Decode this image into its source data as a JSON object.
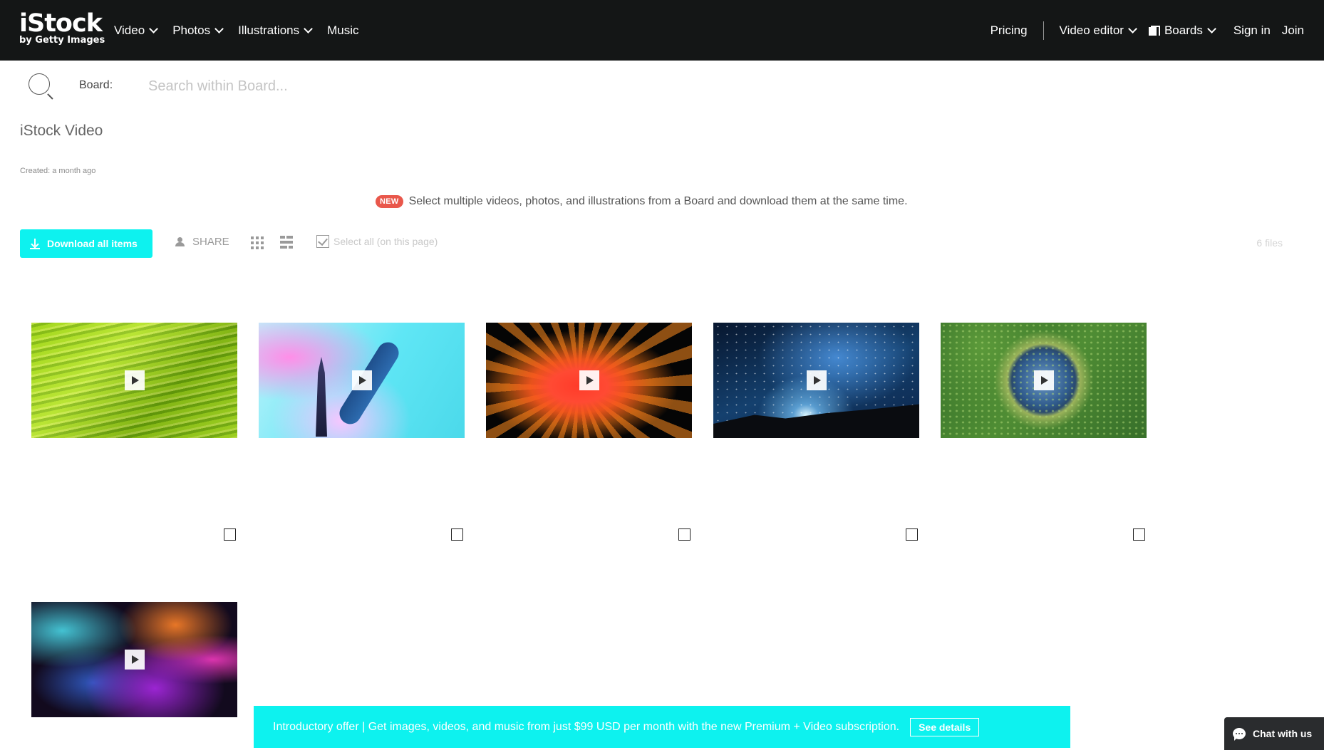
{
  "header": {
    "logo_main": "iStock",
    "logo_sub": "by Getty Images",
    "nav_left": [
      {
        "label": "Video",
        "dropdown": true
      },
      {
        "label": "Photos",
        "dropdown": true
      },
      {
        "label": "Illustrations",
        "dropdown": true
      },
      {
        "label": "Music",
        "dropdown": false
      }
    ],
    "pricing": "Pricing",
    "video_editor": "Video editor",
    "boards": "Boards",
    "sign_in": "Sign in",
    "join": "Join"
  },
  "search": {
    "board_label": "Board:",
    "placeholder": "Search within Board..."
  },
  "board": {
    "title": "iStock Video",
    "created": "Created: a month ago"
  },
  "notice": {
    "badge": "NEW",
    "text": "Select multiple videos, photos, and illustrations from a Board and download them at the same time."
  },
  "toolbar": {
    "download_all": "Download all items",
    "share": "SHARE",
    "select_all": "Select all (on this page)",
    "file_count": "6 files"
  },
  "items": [
    {
      "subject": "green grass",
      "type": "video"
    },
    {
      "subject": "skyscraper and boat above clouds",
      "type": "video"
    },
    {
      "subject": "red powder explosion",
      "type": "video"
    },
    {
      "subject": "milky way night sky",
      "type": "video"
    },
    {
      "subject": "aerial round pond",
      "type": "video"
    },
    {
      "subject": "colorful abstract smoke",
      "type": "video"
    }
  ],
  "promo": {
    "text": "Introductory offer | Get images, videos, and music from just $99 USD per month with the new Premium + Video subscription.",
    "button": "See details"
  },
  "chat": {
    "label": "Chat with us"
  },
  "colors": {
    "header_bg": "#141616",
    "accent": "#0df2ef",
    "new_badge": "#e9574b"
  }
}
